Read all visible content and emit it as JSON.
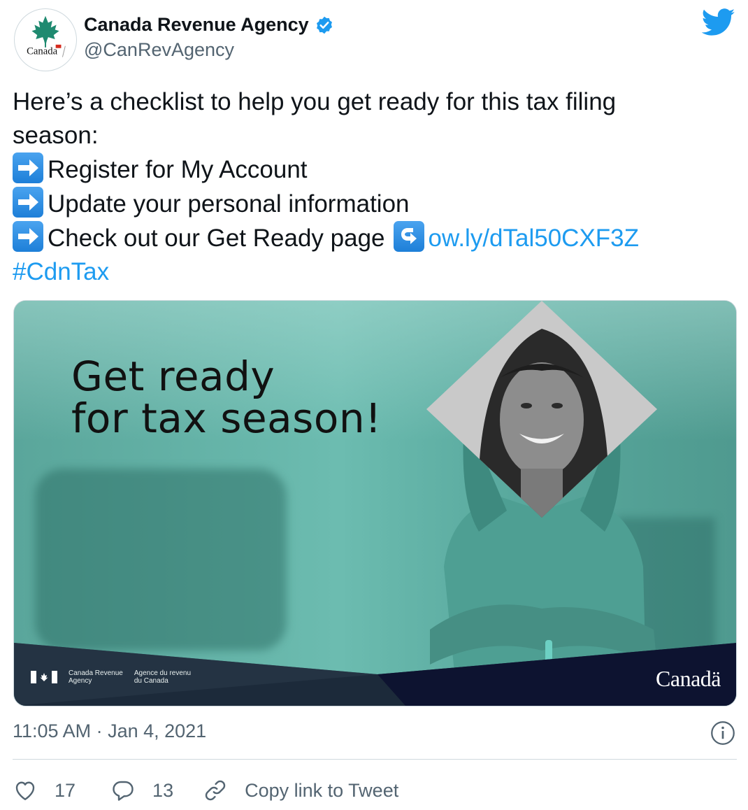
{
  "header": {
    "display_name": "Canada Revenue Agency",
    "handle": "@CanRevAgency",
    "avatar_wordmark": "Canadä",
    "verified": true
  },
  "tweet": {
    "line1": "Here’s a checklist to help you get ready for this tax filing",
    "line2": "season:",
    "item1": "Register for My Account",
    "item2": "Update your personal information",
    "item3": "Check out our Get Ready page",
    "link": "ow.ly/dTal50CXF3Z",
    "hashtag": "#CdnTax"
  },
  "media": {
    "headline_line1": "Get ready",
    "headline_line2": "for tax season!",
    "fip_en_line1": "Canada Revenue",
    "fip_en_line2": "Agency",
    "fip_fr_line1": "Agence du revenu",
    "fip_fr_line2": "du Canada",
    "wordmark": "Canadä"
  },
  "timestamp": "11:05 AM · Jan 4, 2021",
  "actions": {
    "likes": "17",
    "replies": "13",
    "copy_link": "Copy link to Tweet"
  },
  "colors": {
    "link": "#1d9bf0",
    "secondary_text": "#536471",
    "teal": "#6cbcb0",
    "navy_band": "#0d1330"
  }
}
